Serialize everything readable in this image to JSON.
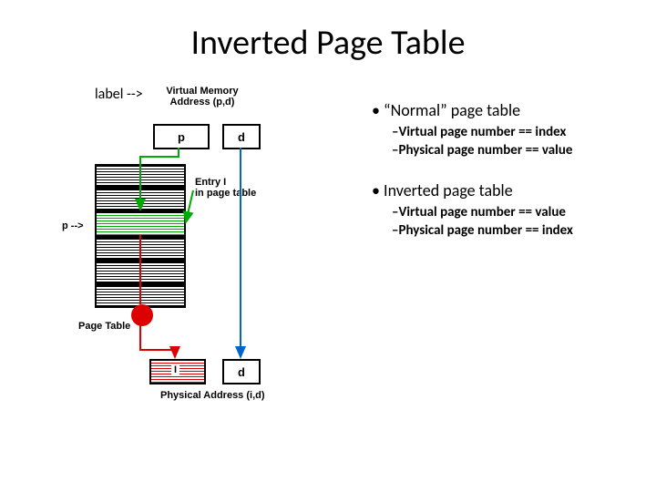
{
  "title": "Inverted Page Table",
  "bullets": {
    "normal": {
      "heading": "“Normal” page table",
      "sub1": "Virtual page number == index",
      "sub2": "Physical page number == value"
    },
    "inverted": {
      "heading": "Inverted page table",
      "sub1": "Virtual page number == value",
      "sub2": "Physical page number == index"
    }
  },
  "diagram": {
    "vm_addr_label": "Virtual Memory\nAddress (p,d)",
    "p": "p",
    "d_top": "d",
    "entry_label": "Entry I\nin page table",
    "p_arrow": "p -->",
    "page_table_label": "Page Table",
    "i": "I",
    "d_bot": "d",
    "phys_addr_label": "Physical Address (i,d)"
  }
}
